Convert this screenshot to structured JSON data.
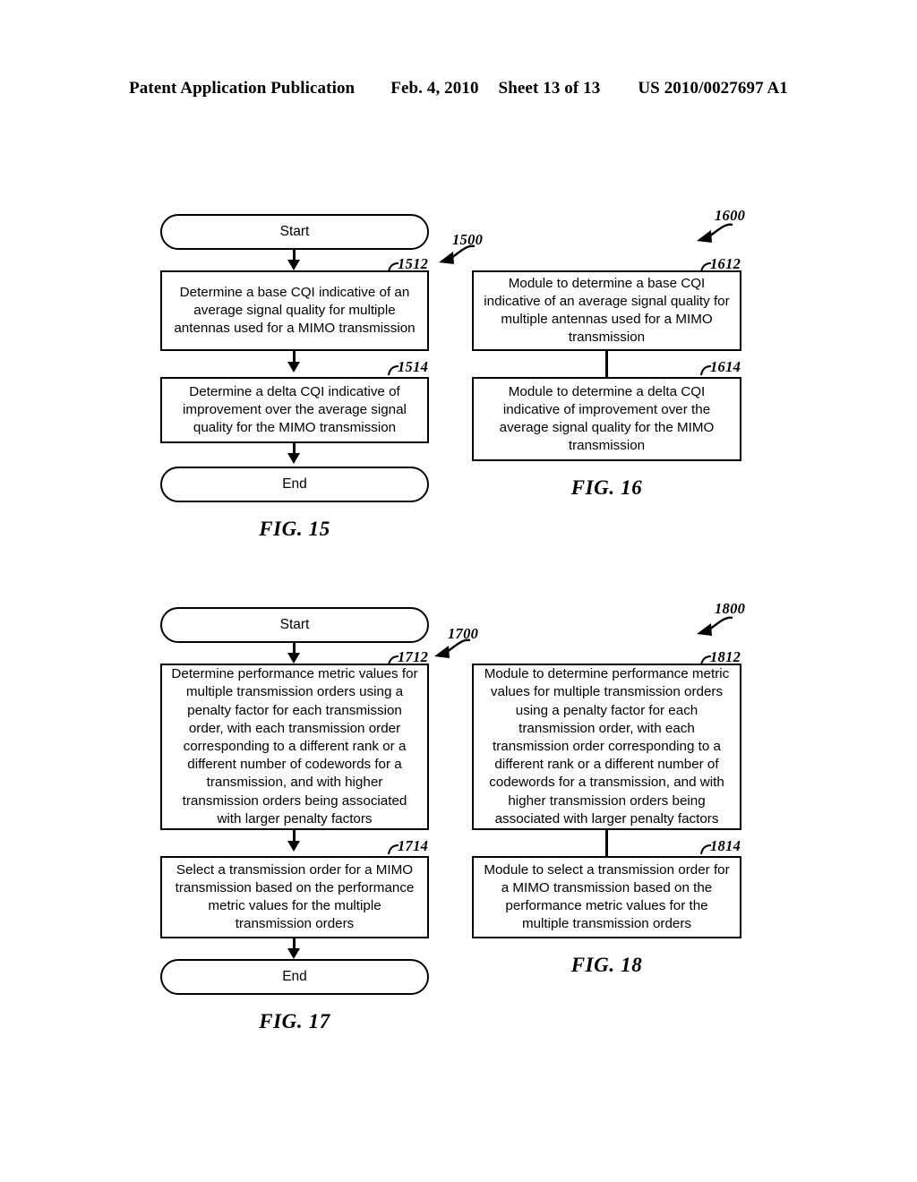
{
  "header": {
    "publication": "Patent Application Publication",
    "date": "Feb. 4, 2010",
    "sheet": "Sheet 13 of 13",
    "patent_number": "US 2010/0027697 A1"
  },
  "figures": [
    {
      "caption": "FIG. 15",
      "flow_ref": "1500",
      "nodes": [
        {
          "ref": "",
          "text": "Start"
        },
        {
          "ref": "1512",
          "text": "Determine a base CQI indicative of an average signal quality for multiple antennas used for a MIMO transmission"
        },
        {
          "ref": "1514",
          "text": "Determine a delta CQI indicative of improvement over the average signal quality for the MIMO transmission"
        },
        {
          "ref": "",
          "text": "End"
        }
      ]
    },
    {
      "caption": "FIG. 16",
      "flow_ref": "1600",
      "nodes": [
        {
          "ref": "1612",
          "text": "Module to determine a base CQI indicative of an average signal quality for multiple antennas used for a MIMO transmission"
        },
        {
          "ref": "1614",
          "text": "Module to determine a delta CQI indicative of improvement over the average signal quality for the MIMO transmission"
        }
      ]
    },
    {
      "caption": "FIG. 17",
      "flow_ref": "1700",
      "nodes": [
        {
          "ref": "",
          "text": "Start"
        },
        {
          "ref": "1712",
          "text": "Determine performance metric values for multiple transmission orders using a penalty factor for each transmission order, with each transmission order corresponding to a different rank or a different number of codewords for a transmission, and with higher transmission orders being associated with larger penalty factors"
        },
        {
          "ref": "1714",
          "text": "Select a transmission order for a MIMO transmission based on the performance metric values for the multiple transmission orders"
        },
        {
          "ref": "",
          "text": "End"
        }
      ]
    },
    {
      "caption": "FIG. 18",
      "flow_ref": "1800",
      "nodes": [
        {
          "ref": "1812",
          "text": "Module to determine performance metric values for multiple transmission orders using a penalty factor for each transmission order, with each transmission order corresponding to a different rank or a different number of codewords for a transmission, and with higher transmission orders being associated with larger penalty factors"
        },
        {
          "ref": "1814",
          "text": "Module to select a transmission order for a MIMO transmission based on the performance metric values for the multiple transmission orders"
        }
      ]
    }
  ]
}
